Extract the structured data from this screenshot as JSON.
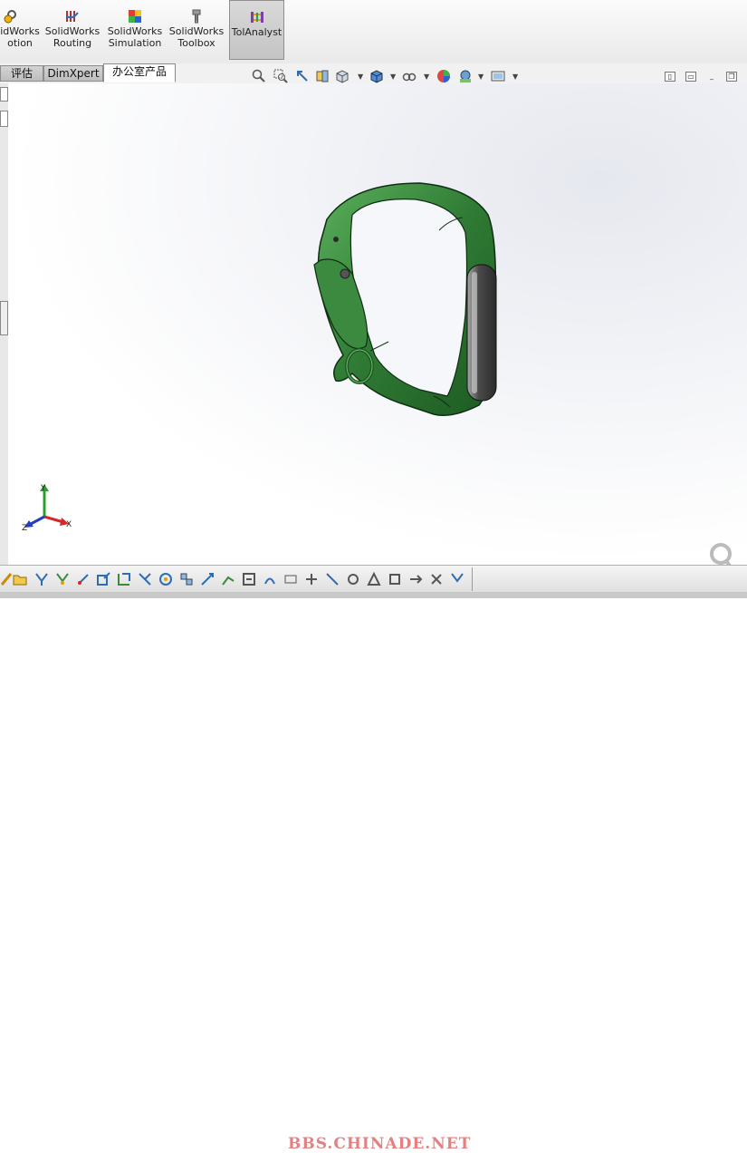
{
  "ribbon": {
    "items": [
      {
        "line1": "idWorks",
        "line2": "otion",
        "icon": "motion-icon"
      },
      {
        "line1": "SolidWorks",
        "line2": "Routing",
        "icon": "routing-icon"
      },
      {
        "line1": "SolidWorks",
        "line2": "Simulation",
        "icon": "simulation-icon"
      },
      {
        "line1": "SolidWorks",
        "line2": "Toolbox",
        "icon": "toolbox-icon"
      },
      {
        "line1": "TolAnalyst",
        "line2": "",
        "icon": "tolanalyst-icon"
      }
    ]
  },
  "tabs": [
    {
      "label": "评估"
    },
    {
      "label": "DimXpert"
    },
    {
      "label": "办公室产品"
    }
  ],
  "active_tab": "办公室产品",
  "triad": {
    "x": "X",
    "y": "Y",
    "z": "Z"
  },
  "watermark": "BBS.CHINADE.NET",
  "colors": {
    "band": "#2f7a34",
    "band_dark": "#1c4f20",
    "capsule": "#3c3c3c",
    "accent": "#d04040"
  }
}
